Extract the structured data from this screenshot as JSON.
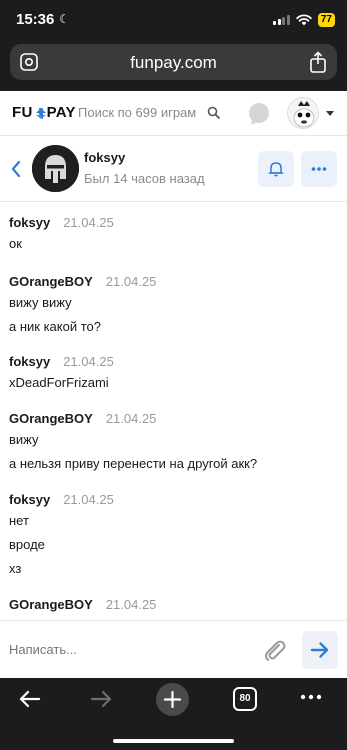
{
  "status_bar": {
    "time": "15:36",
    "battery": "77"
  },
  "browser": {
    "url": "funpay.com",
    "tabs_count": "80"
  },
  "site_header": {
    "logo": {
      "part1": "FU",
      "part2": "PAY"
    },
    "search_placeholder": "Поиск по 699 играм"
  },
  "chat": {
    "name": "foksyy",
    "status": "Был 14 часов назад"
  },
  "messages": [
    {
      "author": "foksyy",
      "date": "21.04.25",
      "lines": [
        "ок"
      ]
    },
    {
      "author": "GOrangeBOY",
      "date": "21.04.25",
      "lines": [
        "вижу вижу",
        "а ник какой то?"
      ]
    },
    {
      "author": "foksyy",
      "date": "21.04.25",
      "lines": [
        "xDeadForFrizami"
      ]
    },
    {
      "author": "GOrangeBOY",
      "date": "21.04.25",
      "lines": [
        "вижу",
        "а нельзя приву перенести на другой акк?"
      ]
    },
    {
      "author": "foksyy",
      "date": "21.04.25",
      "lines": [
        "нет",
        "вроде",
        "хз"
      ]
    },
    {
      "author": "GOrangeBOY",
      "date": "21.04.25",
      "lines": []
    }
  ],
  "compose": {
    "placeholder": "Написать..."
  },
  "colors": {
    "accent": "#2d7fd3",
    "chrome": "#1c1c1e"
  }
}
